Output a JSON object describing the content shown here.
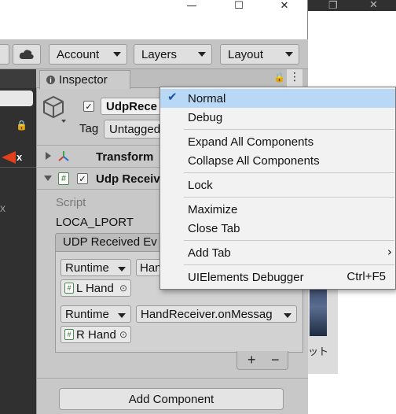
{
  "window": {
    "controls": [
      "—",
      "☐",
      "✕"
    ]
  },
  "toolbar": {
    "account": "Account",
    "layers": "Layers",
    "layout": "Layout"
  },
  "inspector": {
    "tab_label": "Inspector",
    "object_name": "UdpRece",
    "tag_label": "Tag",
    "tag_value": "Untagged",
    "transform_label": "Transform",
    "udp_component_label": "Udp Receiv",
    "script_label": "Script",
    "port_label": "LOCA_LPORT",
    "event_label": "UDP Received Ev",
    "event_rows": [
      {
        "mode": "Runtime",
        "function": "Hand",
        "object": "L Hand"
      },
      {
        "mode": "Runtime",
        "function": "HandReceiver.onMessag",
        "object": "R Hand"
      }
    ],
    "add_btn": "+",
    "remove_btn": "−",
    "add_component": "Add Component"
  },
  "context_menu": {
    "items": [
      {
        "label": "Normal",
        "checked": true
      },
      {
        "label": "Debug"
      },
      {
        "label": "Expand All Components"
      },
      {
        "label": "Collapse All Components"
      },
      {
        "label": "Lock"
      },
      {
        "label": "Maximize"
      },
      {
        "label": "Close Tab"
      },
      {
        "label": "Add Tab",
        "submenu": true
      },
      {
        "label": "UIElements Debugger",
        "shortcut": "Ctrl+F5"
      }
    ]
  },
  "bg_window": {
    "text": "ット"
  },
  "colors": {
    "selection": "#b9d8f5",
    "check": "#1a55a8",
    "panel": "#c8c8c8"
  }
}
